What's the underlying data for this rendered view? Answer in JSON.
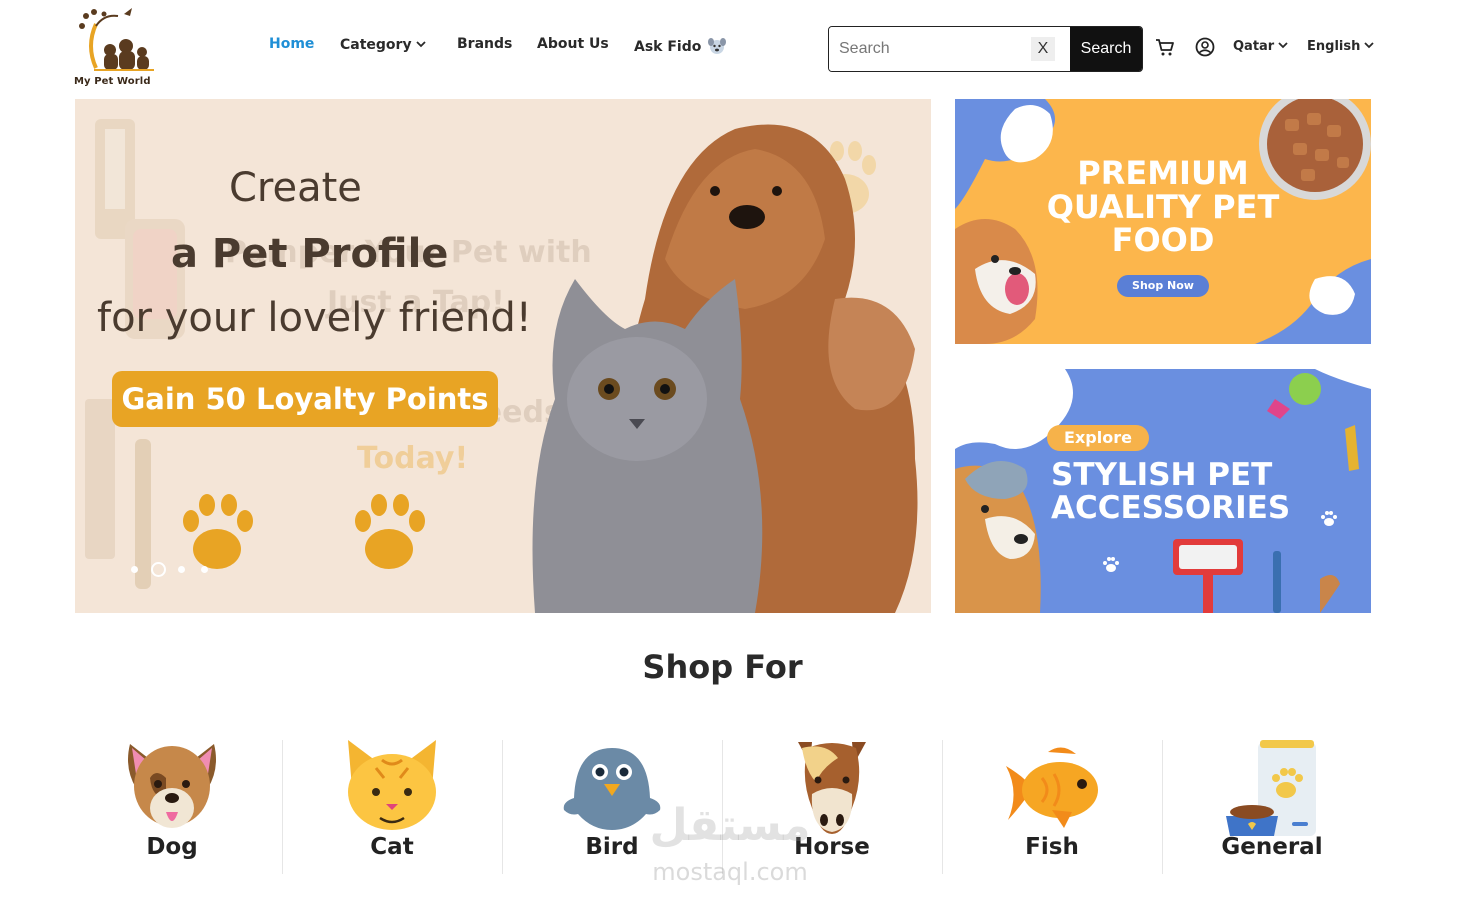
{
  "header": {
    "logo_text": "My Pet World",
    "nav": [
      {
        "label": "Home",
        "active": true
      },
      {
        "label": "Category",
        "active": false
      },
      {
        "label": "Brands",
        "active": false
      },
      {
        "label": "About Us",
        "active": false
      },
      {
        "label": "Ask Fido",
        "active": false
      }
    ],
    "search": {
      "placeholder": "Search",
      "value": "",
      "clear_label": "X",
      "button_label": "Search"
    },
    "country": "Qatar",
    "language": "English",
    "accent_color": "#1f8fd6"
  },
  "hero": {
    "line1": "Create",
    "line2": "a Pet Profile",
    "line3": "for your lovely friend!",
    "pill": "Gain 50 Loyalty Points",
    "bg_text_1": "Pamper Your Pet with",
    "bg_text_2": "Just a Tap!",
    "bg_text_3": "Get All Their Needs",
    "bg_text_4": "Today!",
    "slides": 4,
    "active_slide": 2
  },
  "banners": {
    "food": {
      "title": "PREMIUM QUALITY PET FOOD",
      "button": "Shop Now"
    },
    "accessories": {
      "tag": "Explore",
      "title": "STYLISH PET ACCESSORIES"
    }
  },
  "shop_for": {
    "title": "Shop For",
    "categories": [
      {
        "label": "Dog",
        "icon": "dog-icon"
      },
      {
        "label": "Cat",
        "icon": "cat-icon"
      },
      {
        "label": "Bird",
        "icon": "bird-icon"
      },
      {
        "label": "Horse",
        "icon": "horse-icon"
      },
      {
        "label": "Fish",
        "icon": "fish-icon"
      },
      {
        "label": "General",
        "icon": "pet-food-icon"
      }
    ]
  },
  "watermark": {
    "arabic": "مستقل",
    "latin": "mostaql.com"
  }
}
